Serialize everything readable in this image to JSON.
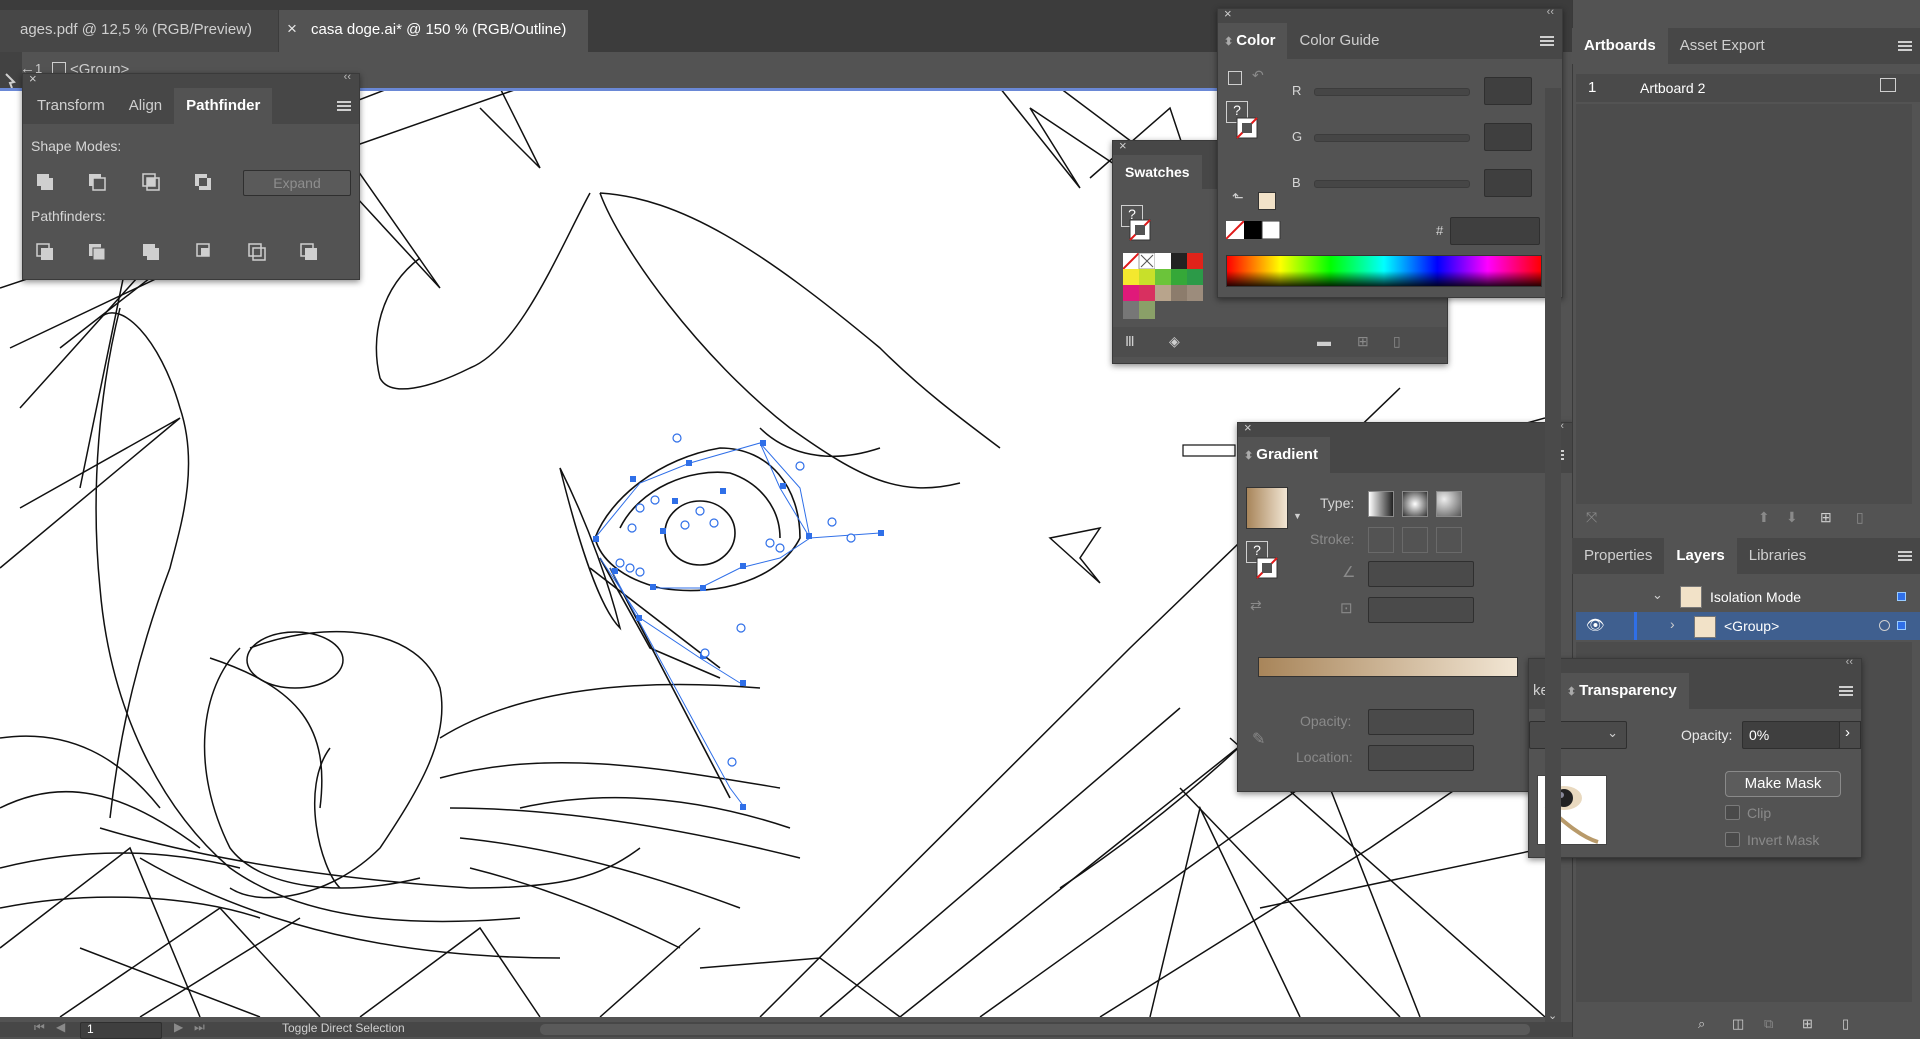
{
  "doc_tabs": [
    {
      "label": "ages.pdf @ 12,5 % (RGB/Preview)",
      "active": false
    },
    {
      "label": "casa doge.ai* @ 150 % (RGB/Outline)",
      "active": true,
      "close": "×"
    }
  ],
  "breadcrumb": {
    "back": "←",
    "num": "1",
    "label": "<Group>"
  },
  "pathfinder_panel": {
    "tabs": [
      "Transform",
      "Align",
      "Pathfinder"
    ],
    "active_tab": "Pathfinder",
    "shape_modes_label": "Shape Modes:",
    "pathfinders_label": "Pathfinders:",
    "expand_label": "Expand",
    "shape_mode_icons": [
      "unite-icon",
      "minus-front-icon",
      "intersect-icon",
      "exclude-icon"
    ],
    "pathfinder_icons": [
      "divide-icon",
      "trim-icon",
      "merge-icon",
      "crop-icon",
      "outline-icon",
      "minus-back-icon"
    ]
  },
  "color_panel": {
    "tabs": [
      "Color",
      "Color Guide"
    ],
    "active_tab": "Color",
    "channels": [
      "R",
      "G",
      "B"
    ],
    "hex_label": "#",
    "swatch_color": "#f2e2c8"
  },
  "swatches_panel": {
    "title": "Swatches",
    "colors": [
      "none",
      "#ffffff",
      "#ffffff",
      "#222222",
      "#e0231a",
      "#f4e82e",
      "#c8e02a",
      "#35a838",
      "#2c9a48",
      "#e0197a",
      "#b8a48c",
      "#8c7c6c",
      "#9c8c7c",
      "#8aa068"
    ]
  },
  "gradient_panel": {
    "title": "Gradient",
    "type_label": "Type:",
    "stroke_label": "Stroke:",
    "opacity_label": "Opacity:",
    "location_label": "Location:",
    "gradient_start": "#a8855a",
    "gradient_end": "#f2e6d4"
  },
  "artboards_panel": {
    "tabs": [
      "Artboards",
      "Asset Export"
    ],
    "active_tab": "Artboards",
    "rows": [
      {
        "num": "1",
        "name": "Artboard 2"
      }
    ]
  },
  "layers_panel": {
    "tabs": [
      "Properties",
      "Layers",
      "Libraries"
    ],
    "active_tab": "Layers",
    "rows": [
      {
        "name": "Isolation Mode",
        "expanded": true
      },
      {
        "name": "<Group>",
        "expanded": false,
        "visible_icon": "eye-icon"
      }
    ]
  },
  "transparency_panel": {
    "tabs": [
      "ke",
      "Transparency"
    ],
    "active_tab": "Transparency",
    "opacity_label": "Opacity:",
    "opacity_value": "0%",
    "make_mask_label": "Make Mask",
    "clip_label": "Clip",
    "invert_mask_label": "Invert Mask"
  },
  "status_bar": {
    "page": "1",
    "tool_label": "Toggle Direct Selection"
  },
  "colors": {
    "app_bg": "#535353",
    "panel_bg": "#535353",
    "selection_blue": "#2f6fe8",
    "canvas": "#ffffff"
  }
}
